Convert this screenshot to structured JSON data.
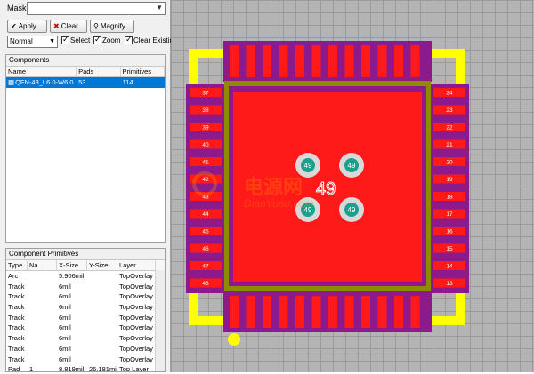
{
  "mask": {
    "label": "Mask",
    "value": ""
  },
  "toolbar": {
    "apply": "Apply",
    "clear": "Clear",
    "magnify": "Magnify"
  },
  "options": {
    "mode": "Normal",
    "select": "Select",
    "zoom": "Zoom",
    "clear_existing": "Clear Existin"
  },
  "components": {
    "title": "Components",
    "columns": [
      "Name",
      "Pads",
      "Primitives"
    ],
    "rows": [
      {
        "name": "QFN-48_L6.0-W6.0",
        "pads": "53",
        "primitives": "114"
      }
    ]
  },
  "primitives": {
    "title": "Component Primitives",
    "columns": [
      "Type",
      "Na...",
      "X-Size",
      "Y-Size",
      "Layer"
    ],
    "rows": [
      [
        "Arc",
        "",
        "5.906mil",
        "",
        "TopOverlay"
      ],
      [
        "Track",
        "",
        "6mil",
        "",
        "TopOverlay"
      ],
      [
        "Track",
        "",
        "6mil",
        "",
        "TopOverlay"
      ],
      [
        "Track",
        "",
        "6mil",
        "",
        "TopOverlay"
      ],
      [
        "Track",
        "",
        "6mil",
        "",
        "TopOverlay"
      ],
      [
        "Track",
        "",
        "6mil",
        "",
        "TopOverlay"
      ],
      [
        "Track",
        "",
        "6mil",
        "",
        "TopOverlay"
      ],
      [
        "Track",
        "",
        "6mil",
        "",
        "TopOverlay"
      ],
      [
        "Track",
        "",
        "6mil",
        "",
        "TopOverlay"
      ],
      [
        "Pad",
        "1",
        "8.819mil",
        "26.181mil",
        "Top Layer"
      ]
    ]
  },
  "pcb": {
    "left_pads": [
      "37",
      "38",
      "39",
      "40",
      "41",
      "42",
      "43",
      "44",
      "45",
      "46",
      "47",
      "48"
    ],
    "right_pads": [
      "24",
      "23",
      "22",
      "21",
      "20",
      "19",
      "18",
      "17",
      "16",
      "15",
      "14",
      "13"
    ],
    "center_pad": "49",
    "via_label": "49",
    "watermark": "电源网",
    "watermark_url": "DianYuan.com",
    "colors": {
      "pad": "#ff1a1a",
      "mask": "#8c1a8c",
      "overlay": "#ffff00",
      "body": "#8c8c00"
    }
  }
}
